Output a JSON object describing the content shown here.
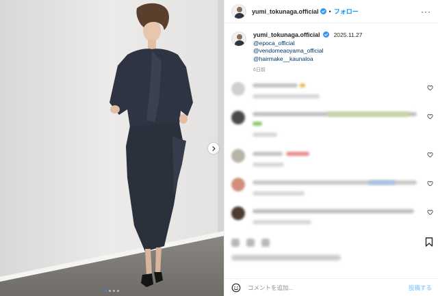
{
  "header": {
    "username": "yumi_tokunaga.official",
    "separator": "•",
    "follow_label": "フォロー",
    "more_label": "···"
  },
  "post": {
    "username": "yumi_tokunaga.official",
    "date": "2025.11.27",
    "tags": [
      "@epoca_official",
      "@vendomeaoyama_official",
      "@hairmake__kaunaloa"
    ],
    "time_ago": "6日前"
  },
  "carousel": {
    "slide_count": 4,
    "current_index": 0
  },
  "comments_blurred": true,
  "comment_box": {
    "placeholder": "コメントを追加...",
    "post_label": "投稿する"
  },
  "colors": {
    "accent": "#0095f6",
    "verified": "#3897f0",
    "post_button": "#9fd3fc",
    "outfit": "#2f3442"
  },
  "icons": [
    "chevron-right-icon",
    "verified-badge-icon",
    "heart-icon",
    "bookmark-icon",
    "emoji-icon"
  ]
}
